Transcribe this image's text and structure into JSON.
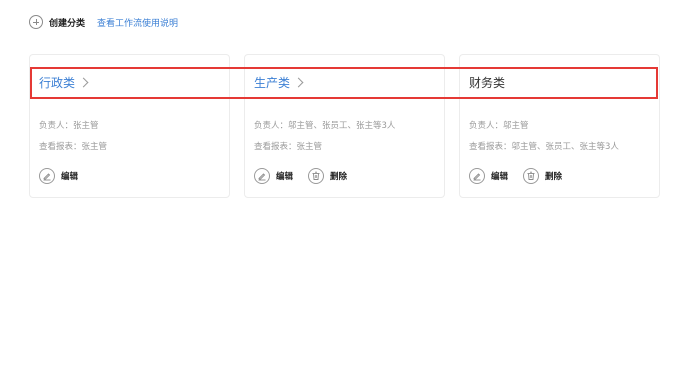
{
  "toolbar": {
    "create_label": "创建分类",
    "help_link": "查看工作流使用说明"
  },
  "cards": [
    {
      "title": "行政类",
      "title_is_link": true,
      "owner": "负责人：张主管",
      "viewer": "查看报表：张主管",
      "edit_label": "编辑",
      "delete_label": ""
    },
    {
      "title": "生产类",
      "title_is_link": true,
      "owner": "负责人：邬主管、张员工、张主等3人",
      "viewer": "查看报表：张主管",
      "edit_label": "编辑",
      "delete_label": "删除"
    },
    {
      "title": "财务类",
      "title_is_link": false,
      "owner": "负责人：邬主管",
      "viewer": "查看报表：邬主管、张员工、张主等3人",
      "edit_label": "编辑",
      "delete_label": "删除"
    }
  ],
  "colors": {
    "link": "#3b7fd4",
    "highlight": "#e53935",
    "muted_text": "#9a9a9a"
  }
}
